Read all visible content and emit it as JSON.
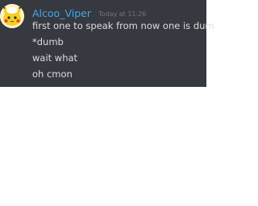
{
  "message_group": {
    "author": "Alcoo_Viper",
    "timestamp": "Today at 11:26",
    "name_color": "#43a7e8",
    "avatar_icon": "pikachu-avatar",
    "messages": [
      "first one to speak from now one is dum",
      "*dumb",
      "wait what",
      "oh cmon"
    ]
  }
}
